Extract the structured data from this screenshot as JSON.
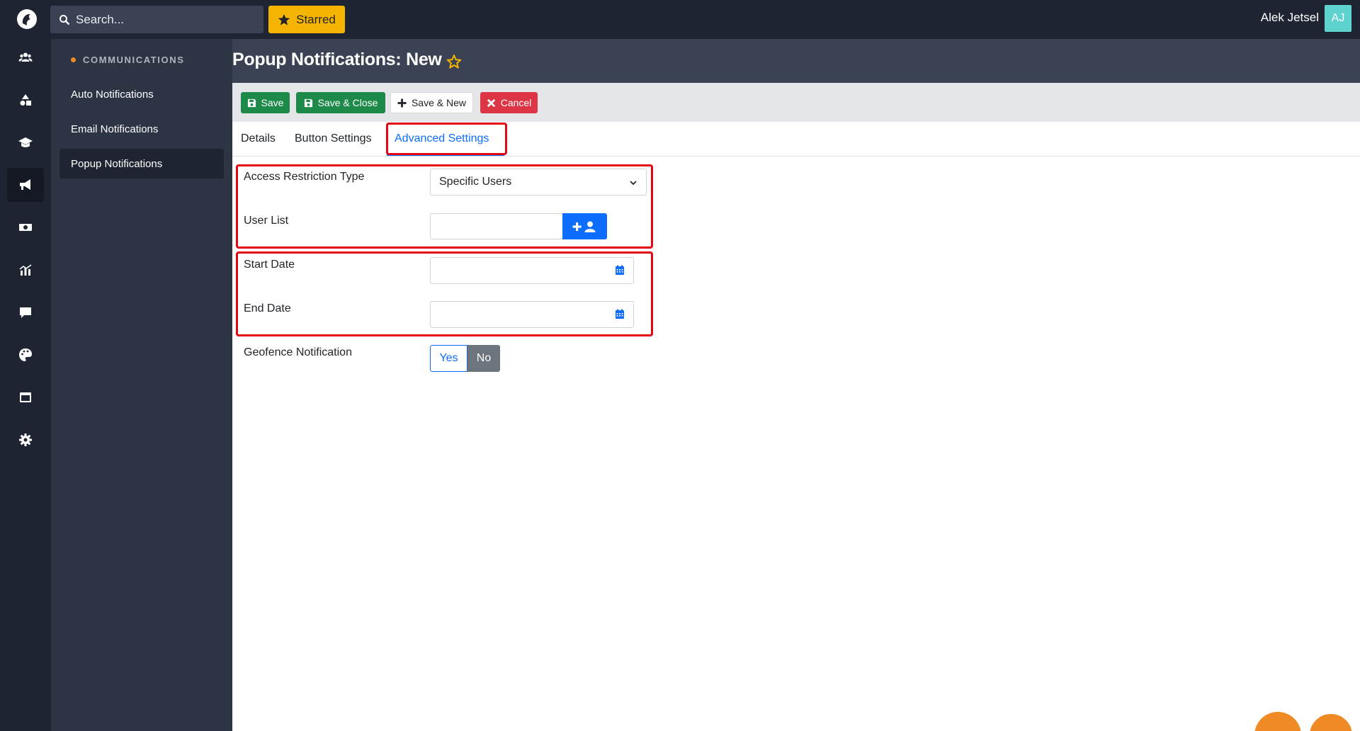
{
  "search": {
    "placeholder": "Search..."
  },
  "starred": {
    "label": "Starred"
  },
  "user": {
    "name": "Alek Jetsel",
    "initials": "AJ"
  },
  "rail": {
    "items": [
      {
        "icon": "users-icon"
      },
      {
        "icon": "shapes-icon"
      },
      {
        "icon": "graduation-cap-icon"
      },
      {
        "icon": "megaphone-icon",
        "active": true
      },
      {
        "icon": "money-icon"
      },
      {
        "icon": "chart-icon"
      },
      {
        "icon": "chat-icon"
      },
      {
        "icon": "palette-icon"
      },
      {
        "icon": "window-icon"
      },
      {
        "icon": "gear-icon"
      }
    ]
  },
  "subnav": {
    "section": "COMMUNICATIONS",
    "items": [
      {
        "label": "Auto Notifications"
      },
      {
        "label": "Email Notifications"
      },
      {
        "label": "Popup Notifications",
        "active": true
      }
    ]
  },
  "page": {
    "title": "Popup Notifications: New"
  },
  "toolbar": {
    "save": "Save",
    "save_close": "Save & Close",
    "save_new": "Save & New",
    "cancel": "Cancel"
  },
  "tabs": [
    {
      "label": "Details"
    },
    {
      "label": "Button Settings"
    },
    {
      "label": "Advanced Settings",
      "active": true
    }
  ],
  "form": {
    "access_restriction_label": "Access Restriction Type",
    "access_restriction_value": "Specific Users",
    "user_list_label": "User List",
    "start_date_label": "Start Date",
    "end_date_label": "End Date",
    "geofence_label": "Geofence Notification",
    "geofence_yes": "Yes",
    "geofence_no": "No"
  },
  "colors": {
    "accent": "#0d6efd",
    "save_green": "#1e8a4a",
    "cancel_red": "#dc3545",
    "starred_yellow": "#f5b400",
    "highlight_red": "#e30613",
    "brand_orange": "#f08a24"
  }
}
